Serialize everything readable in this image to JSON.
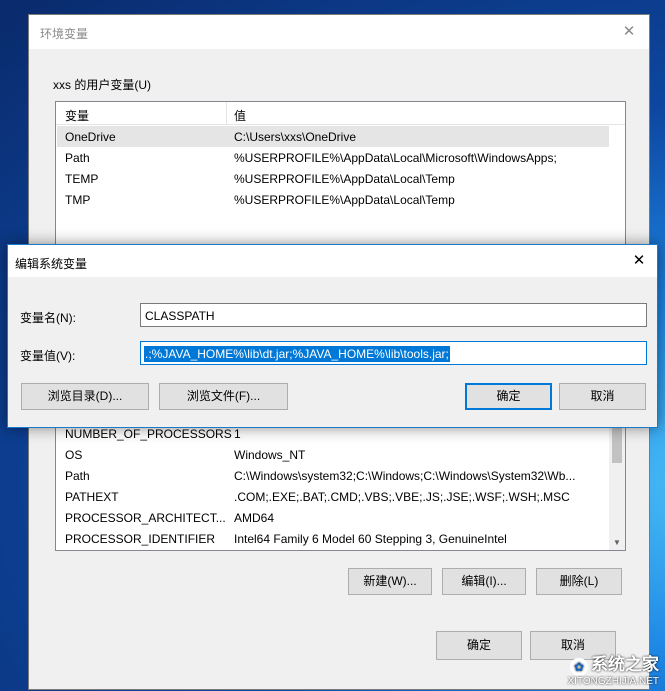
{
  "env_window": {
    "title": "环境变量",
    "close_glyph": "✕",
    "user_vars_label": "xxs 的用户变量(U)",
    "columns": [
      "变量",
      "值"
    ],
    "user_vars": [
      {
        "name": "OneDrive",
        "value": "C:\\Users\\xxs\\OneDrive",
        "selected": true
      },
      {
        "name": "Path",
        "value": "%USERPROFILE%\\AppData\\Local\\Microsoft\\WindowsApps;"
      },
      {
        "name": "TEMP",
        "value": "%USERPROFILE%\\AppData\\Local\\Temp"
      },
      {
        "name": "TMP",
        "value": "%USERPROFILE%\\AppData\\Local\\Temp"
      }
    ],
    "system_vars": [
      {
        "name": "NUMBER_OF_PROCESSORS",
        "value": "1"
      },
      {
        "name": "OS",
        "value": "Windows_NT"
      },
      {
        "name": "Path",
        "value": "C:\\Windows\\system32;C:\\Windows;C:\\Windows\\System32\\Wb..."
      },
      {
        "name": "PATHEXT",
        "value": ".COM;.EXE;.BAT;.CMD;.VBS;.VBE;.JS;.JSE;.WSF;.WSH;.MSC"
      },
      {
        "name": "PROCESSOR_ARCHITECT...",
        "value": "AMD64"
      },
      {
        "name": "PROCESSOR_IDENTIFIER",
        "value": "Intel64 Family 6 Model 60 Stepping 3, GenuineIntel"
      }
    ],
    "sys_buttons": {
      "new": "新建(W)...",
      "edit": "编辑(I)...",
      "delete": "删除(L)"
    },
    "ok": "确定",
    "cancel": "取消"
  },
  "edit_dialog": {
    "title": "编辑系统变量",
    "close_glyph": "✕",
    "name_label": "变量名(N):",
    "name_value": "CLASSPATH",
    "value_label": "变量值(V):",
    "value_value": ".;%JAVA_HOME%\\lib\\dt.jar;%JAVA_HOME%\\lib\\tools.jar;",
    "browse_dir": "浏览目录(D)...",
    "browse_file": "浏览文件(F)...",
    "ok": "确定",
    "cancel": "取消"
  },
  "watermark": {
    "brand": "系统之家",
    "url": "XITONGZHIJIA.NET",
    "logo_glyph": "✿"
  }
}
